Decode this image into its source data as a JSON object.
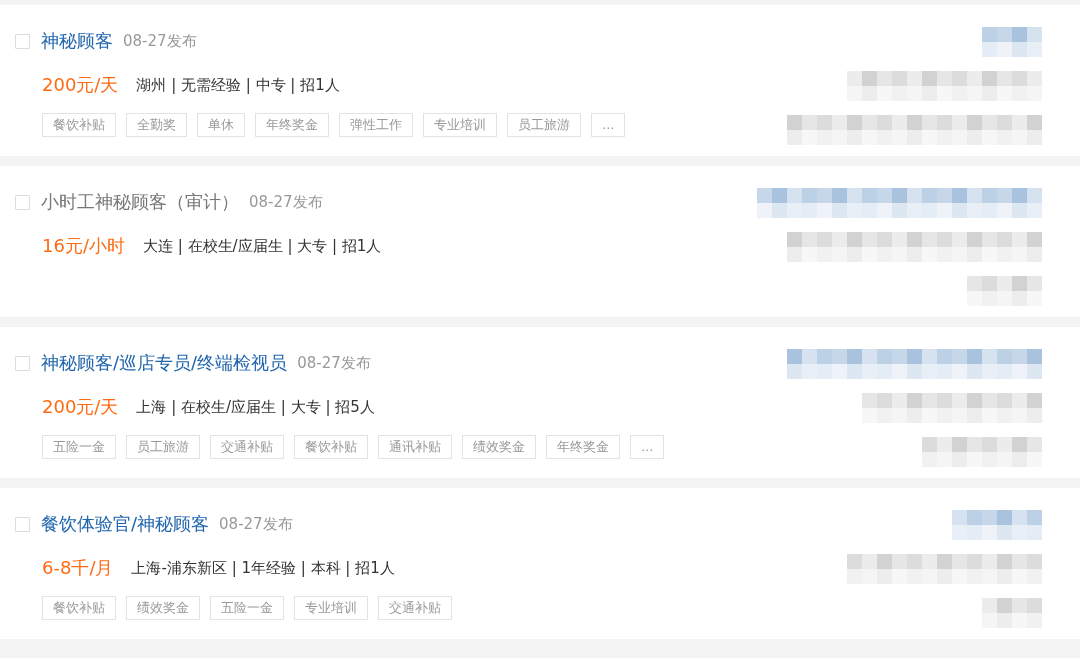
{
  "jobs": [
    {
      "title": "神秘顾客",
      "visited": false,
      "checked": false,
      "date": "08-27发布",
      "salary": "200元/天",
      "info": "湖州 | 无需经验 | 中专 | 招1人",
      "tags": [
        "餐饮补贴",
        "全勤奖",
        "单休",
        "年终奖金",
        "弹性工作",
        "专业培训",
        "员工旅游",
        "..."
      ],
      "redacted": [
        {
          "kind": "company"
        },
        {
          "kind": "info"
        },
        {
          "kind": "info"
        }
      ]
    },
    {
      "title": "小时工神秘顾客（审计）",
      "visited": true,
      "checked": false,
      "date": "08-27发布",
      "salary": "16元/小时",
      "info": "大连 | 在校生/应届生 | 大专 | 招1人",
      "redacted": [
        {
          "kind": "company"
        },
        {
          "kind": "info"
        },
        {
          "kind": "info"
        }
      ]
    },
    {
      "title": "神秘顾客/巡店专员/终端检视员",
      "visited": false,
      "checked": false,
      "date": "08-27发布",
      "salary": "200元/天",
      "info": "上海 | 在校生/应届生 | 大专 | 招5人",
      "tags": [
        "五险一金",
        "员工旅游",
        "交通补贴",
        "餐饮补贴",
        "通讯补贴",
        "绩效奖金",
        "年终奖金",
        "..."
      ],
      "redacted": [
        {
          "kind": "company"
        },
        {
          "kind": "info"
        },
        {
          "kind": "info"
        }
      ]
    },
    {
      "title": "餐饮体验官/神秘顾客",
      "visited": false,
      "checked": false,
      "date": "08-27发布",
      "salary": "6-8千/月",
      "info": "上海-浦东新区 | 1年经验 | 本科 | 招1人",
      "tags": [
        "餐饮补贴",
        "绩效奖金",
        "五险一金",
        "专业培训",
        "交通补贴"
      ],
      "redacted": [
        {
          "kind": "company"
        },
        {
          "kind": "info"
        },
        {
          "kind": "info"
        }
      ]
    }
  ]
}
